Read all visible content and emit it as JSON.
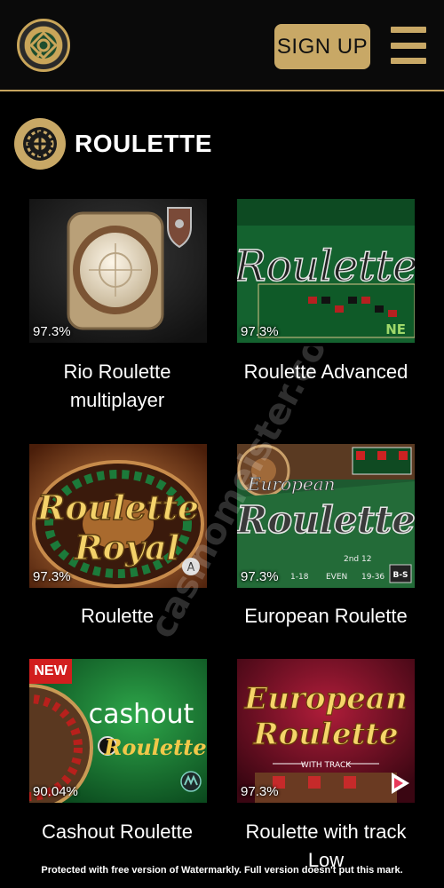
{
  "header": {
    "logo_icon": "casino-roulette-logo-icon",
    "signup_label": "SIGN UP",
    "menu_icon": "hamburger-menu-icon",
    "accent": "#c8a866"
  },
  "section": {
    "icon": "roulette-wheel-icon",
    "title": "ROULETTE"
  },
  "games": [
    {
      "name_line1": "Rio Roulette",
      "name_line2": "multiplayer",
      "rtp": "97.3%"
    },
    {
      "name_line1": "Roulette Advanced",
      "name_line2": "",
      "rtp": "97.3%",
      "art_title": "Roulette",
      "provider": "NE"
    },
    {
      "name_line1": "Roulette",
      "name_line2": "",
      "rtp": "97.3%",
      "art_title": "Roulette Royal",
      "art_line1": "Roulette",
      "art_line2": "Royal",
      "provider": "A"
    },
    {
      "name_line1": "European Roulette",
      "name_line2": "",
      "rtp": "97.3%",
      "art_line1": "European",
      "art_line2": "Roulette",
      "provider": "B-S",
      "table_labels": [
        "2nd 12",
        "1-18",
        "EVEN",
        "19-36"
      ]
    },
    {
      "name_line1": "Cashout Roulette",
      "name_line2": "",
      "rtp": "90.04%",
      "badge": "NEW",
      "art_line1": "cashout",
      "art_line2": "Roulette"
    },
    {
      "name_line1": "Roulette with track",
      "name_line2": "Low",
      "rtp": "97.3%",
      "art_line1": "European",
      "art_line2": "Roulette",
      "art_line3": "WITH TRACK"
    }
  ],
  "watermark": "Protected with free version of Watermarkly. Full version doesn't put this mark.",
  "ghost_text": "casinomeister.co"
}
